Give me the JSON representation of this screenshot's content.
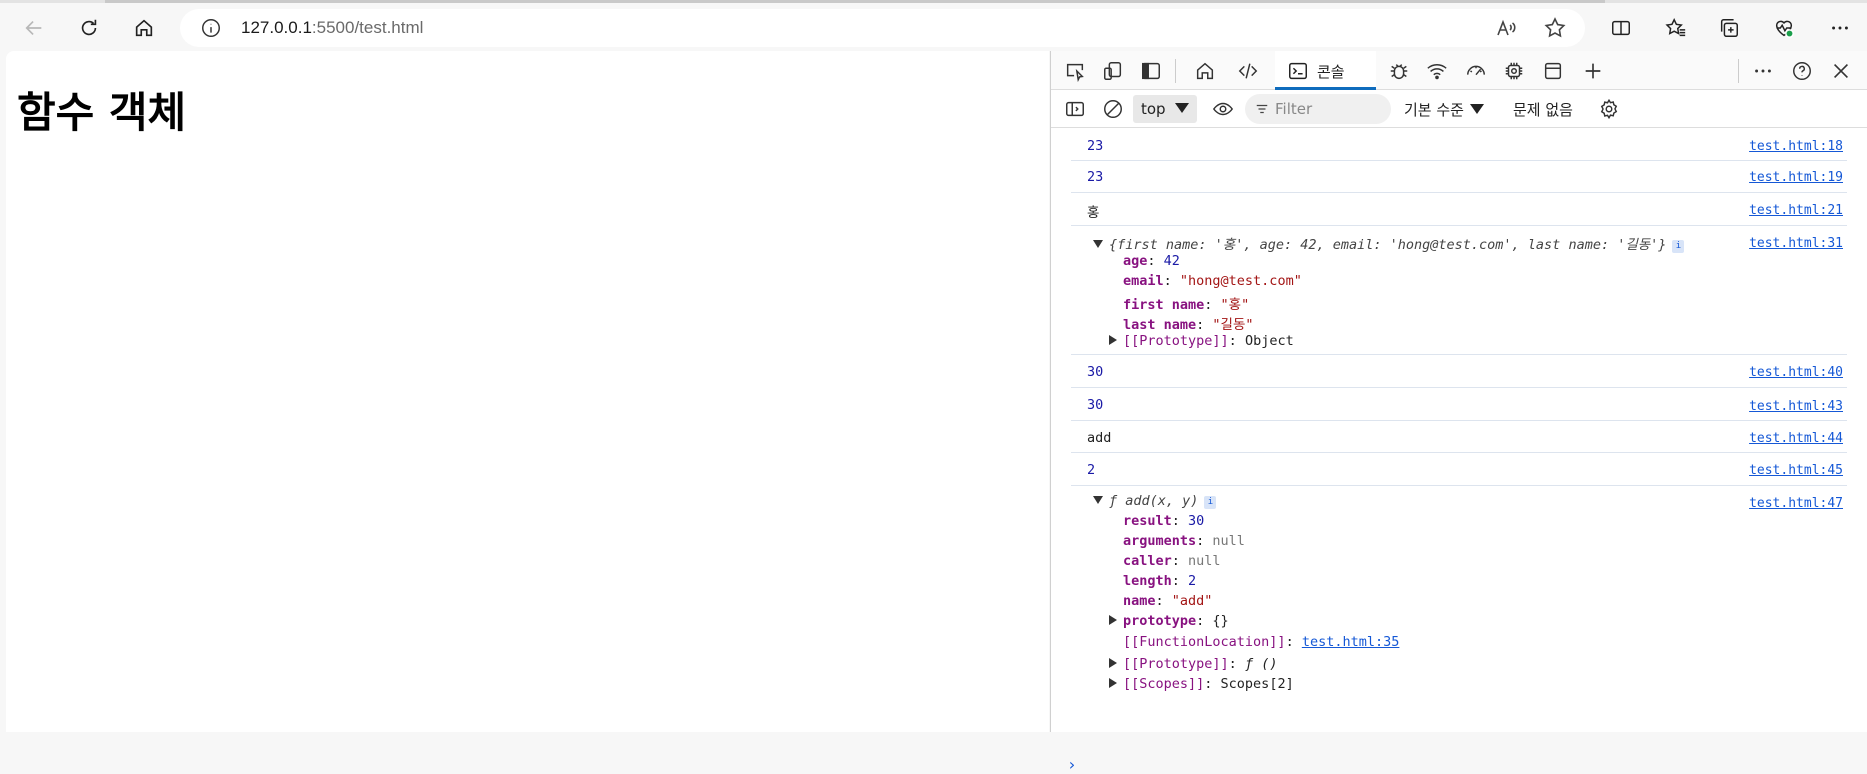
{
  "browser": {
    "url_host": "127.0.0.1",
    "url_rest": ":5500/test.html"
  },
  "page": {
    "heading": "함수 객체"
  },
  "devtools": {
    "console_tab_label": "콘솔",
    "context": "top",
    "filter_placeholder": "Filter",
    "levels_label": "기본 수준",
    "issues_label": "문제 없음"
  },
  "console": {
    "rows": [
      {
        "value": "23",
        "source": "test.html:18"
      },
      {
        "value": "23",
        "source": "test.html:19"
      },
      {
        "value": "홍",
        "source": "test.html:21"
      },
      {
        "value": "{first name: '홍', age: 42, email: 'hong@test.com', last name: '길동'}",
        "source": "test.html:31"
      },
      {
        "value": "30",
        "source": "test.html:40"
      },
      {
        "value": "30",
        "source": "test.html:43"
      },
      {
        "value": "add",
        "source": "test.html:44"
      },
      {
        "value": "2",
        "source": "test.html:45"
      },
      {
        "value": "ƒ add(x, y)",
        "source": "test.html:47"
      }
    ],
    "object_props": [
      {
        "key": "age",
        "value": "42"
      },
      {
        "key": "email",
        "value": "\"hong@test.com\""
      },
      {
        "key": "first name",
        "value": "\"홍\""
      },
      {
        "key": "last name",
        "value": "\"길동\""
      },
      {
        "key": "[[Prototype]]",
        "value": "Object"
      }
    ],
    "function_props": [
      {
        "key": "result",
        "value": "30"
      },
      {
        "key": "arguments",
        "value": "null"
      },
      {
        "key": "caller",
        "value": "null"
      },
      {
        "key": "length",
        "value": "2"
      },
      {
        "key": "name",
        "value": "\"add\""
      },
      {
        "key": "prototype",
        "value": "{}"
      },
      {
        "key": "[[FunctionLocation]]",
        "value": "test.html:35"
      },
      {
        "key": "[[Prototype]]",
        "value": "ƒ ()"
      },
      {
        "key": "[[Scopes]]",
        "value": "Scopes[2]"
      }
    ],
    "badge": "i",
    "prompt": "›"
  }
}
